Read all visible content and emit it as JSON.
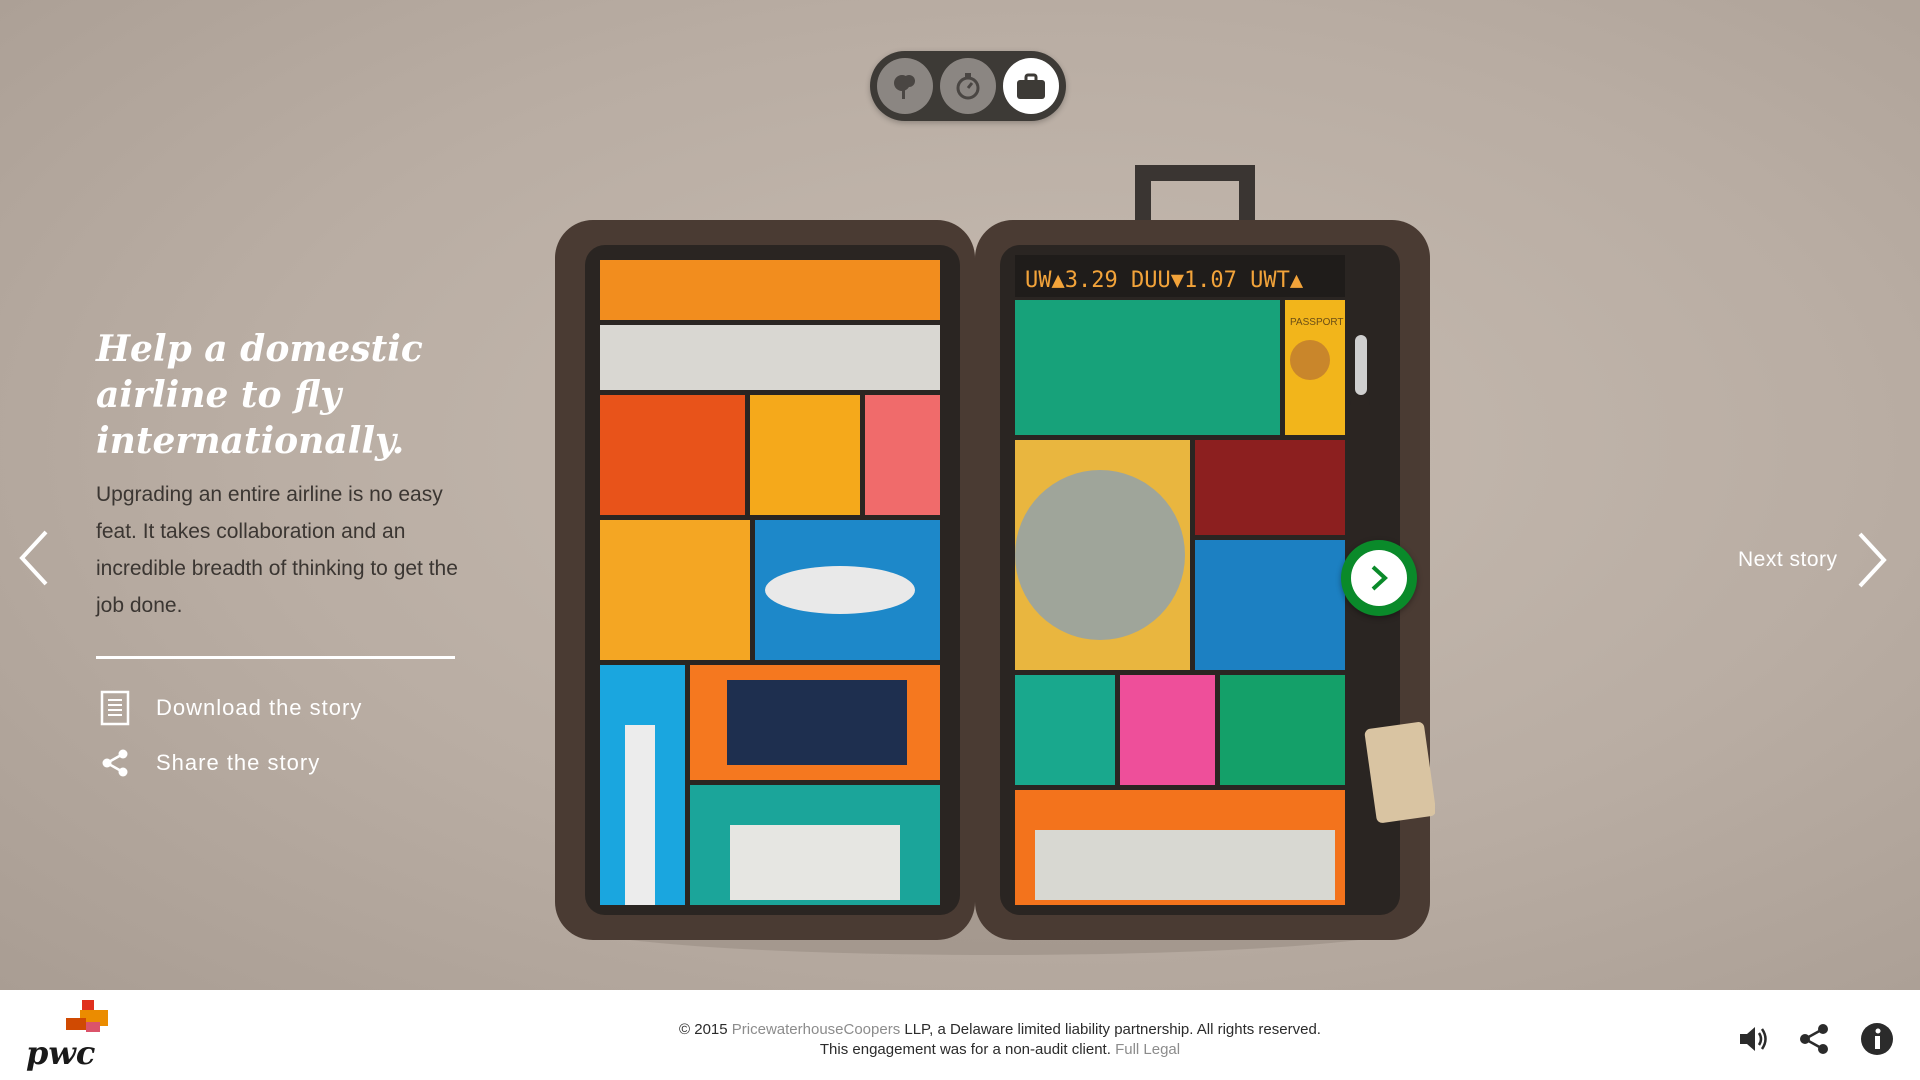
{
  "story": {
    "title": "Help a domestic airline to fly internationally.",
    "body": "Upgrading an entire airline is no easy feat. It takes collaboration and an incredible breadth of thinking to get the job done.",
    "download_label": "Download the story",
    "share_label": "Share the story"
  },
  "navigation": {
    "next_label": "Next story"
  },
  "switcher": {
    "items": [
      "tree-icon",
      "stopwatch-icon",
      "briefcase-icon"
    ],
    "active_index": 2
  },
  "suitcase_display": {
    "ticker_text": "UW▲3.29  DUU▼1.07  UWT▲",
    "passport_text": "PASSPORT"
  },
  "footer": {
    "logo_text": "pwc",
    "copyright_prefix": "© 2015 ",
    "company_link": "PricewaterhouseCoopers",
    "copyright_suffix": " LLP, a Delaware limited liability partnership. All rights reserved.",
    "engagement_text": "This engagement was for a non-audit client. ",
    "legal_link": "Full Legal"
  },
  "colors": {
    "background": "#b9ada3",
    "accent_green": "#0a8a2a",
    "switcher_bg": "#3d3a36",
    "footer_bg": "#ffffff"
  }
}
